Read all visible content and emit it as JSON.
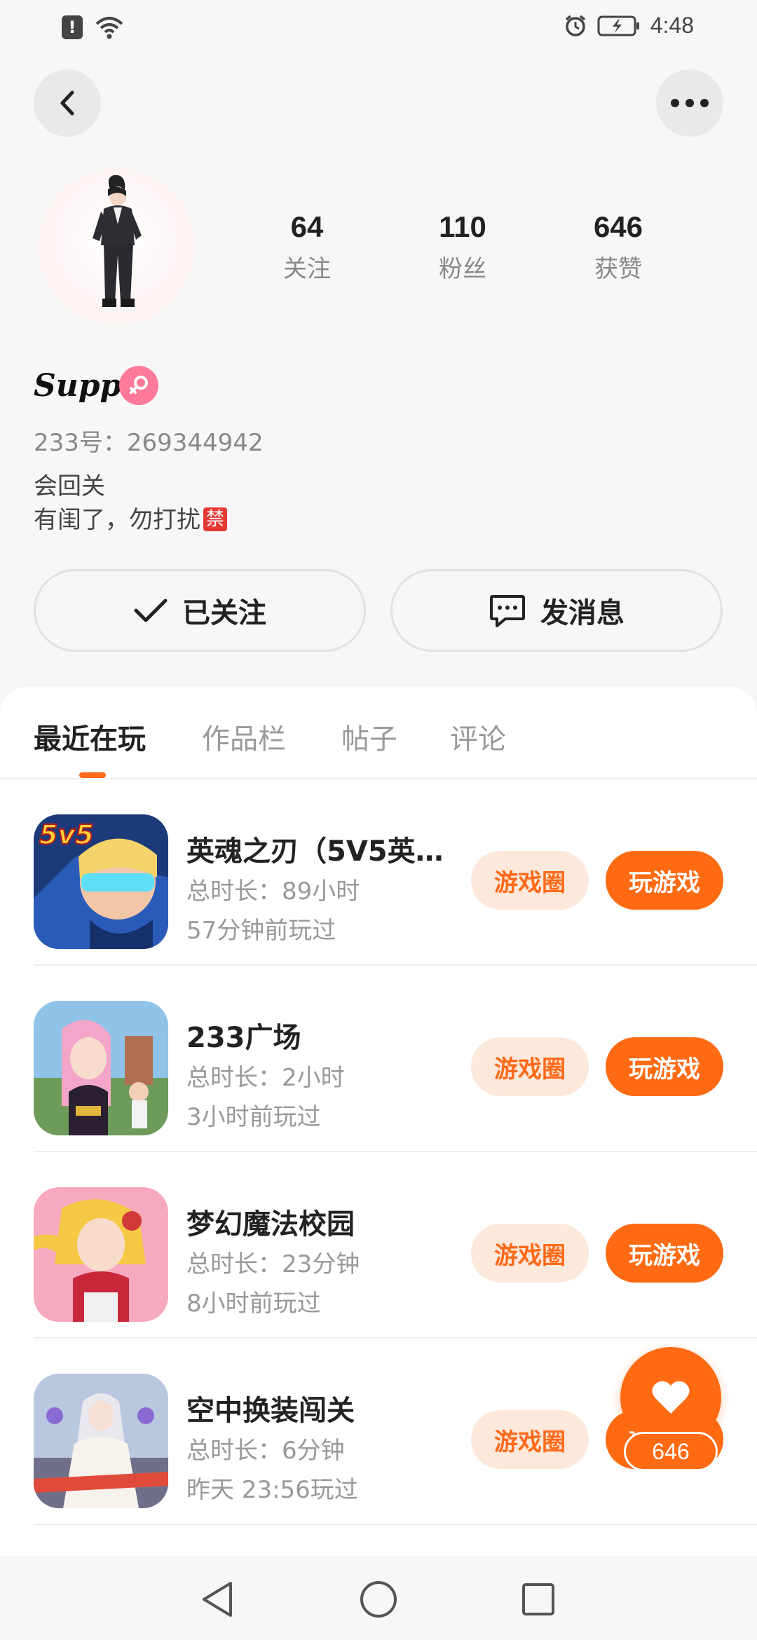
{
  "status_bar": {
    "time": "4:48"
  },
  "profile": {
    "username": "Supp",
    "uid": "233号：269344942",
    "bio_line1": "会回关",
    "bio_line2": "有闺了，勿打扰",
    "bio_badge": "禁",
    "stats": [
      {
        "value": "64",
        "label": "关注"
      },
      {
        "value": "110",
        "label": "粉丝"
      },
      {
        "value": "646",
        "label": "获赞"
      }
    ],
    "follow_label": "已关注",
    "message_label": "发消息"
  },
  "tabs": [
    {
      "label": "最近在玩",
      "active": true
    },
    {
      "label": "作品栏",
      "active": false
    },
    {
      "label": "帖子",
      "active": false
    },
    {
      "label": "评论",
      "active": false
    }
  ],
  "games": [
    {
      "title": "英魂之刃（5V5英…",
      "duration": "总时长：89小时",
      "last_played": "57分钟前玩过",
      "circle_label": "游戏圈",
      "play_label": "玩游戏"
    },
    {
      "title": "233广场",
      "duration": "总时长：2小时",
      "last_played": "3小时前玩过",
      "circle_label": "游戏圈",
      "play_label": "玩游戏"
    },
    {
      "title": "梦幻魔法校园",
      "duration": "总时长：23分钟",
      "last_played": "8小时前玩过",
      "circle_label": "游戏圈",
      "play_label": "玩游戏"
    },
    {
      "title": "空中换装闯关",
      "duration": "总时长：6分钟",
      "last_played": "昨天 23:56玩过",
      "circle_label": "游戏圈",
      "play_label": "玩游戏"
    }
  ],
  "icon_texts": {
    "game1_badge": "5v5"
  },
  "like_fab": {
    "count": "646"
  },
  "colors": {
    "accent": "#ff6a12",
    "accent_light": "#fde9dc",
    "gender_badge": "#ff7a9a"
  },
  "icons": {
    "back": "chevron-left-icon",
    "more": "more-horizontal-icon",
    "follow": "check-icon",
    "message": "chat-bubble-icon",
    "like": "heart-icon",
    "gender": "female-icon"
  }
}
